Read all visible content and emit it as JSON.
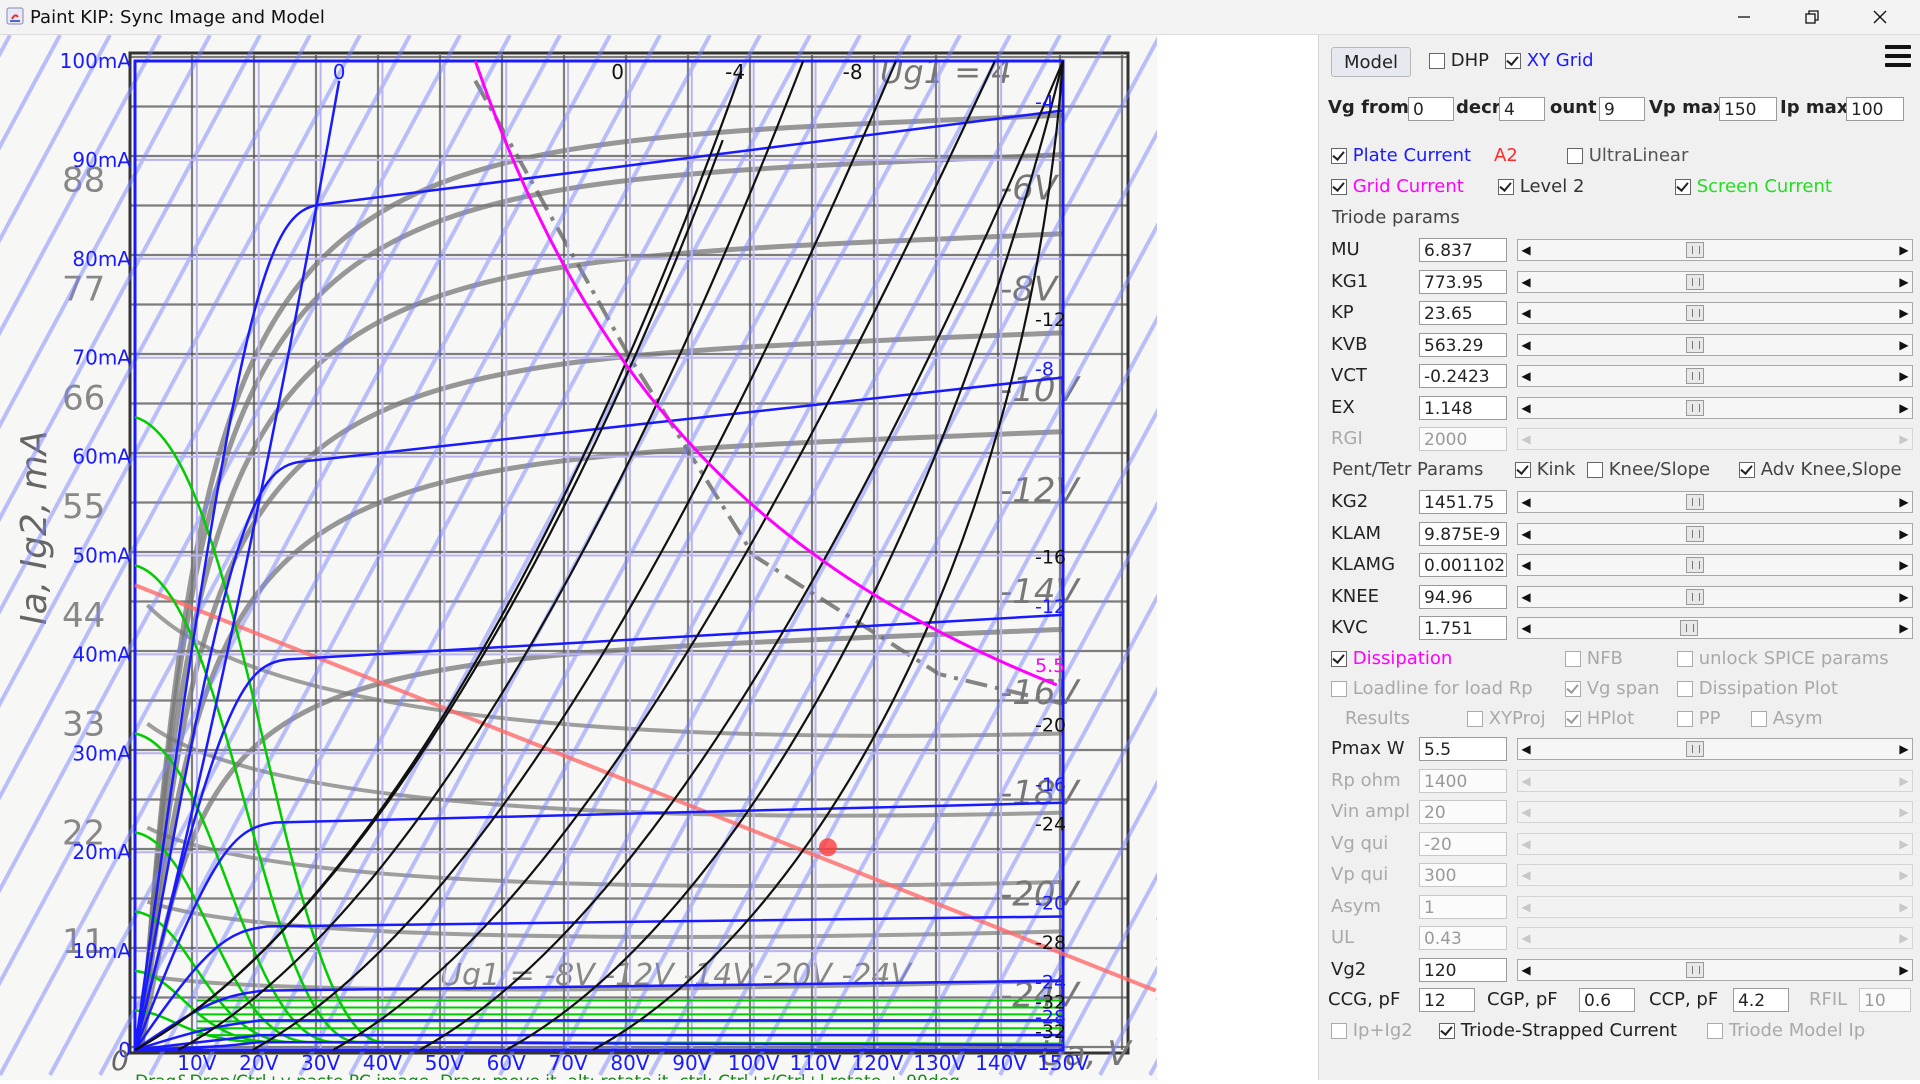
{
  "window": {
    "title": "Paint KIP: Sync Image and Model",
    "controls": [
      "minimize",
      "maximize",
      "close"
    ]
  },
  "plot": {
    "y_ticks": [
      "100mA",
      "90mA",
      "80mA",
      "70mA",
      "60mA",
      "50mA",
      "40mA",
      "30mA",
      "20mA",
      "10mA",
      "0"
    ],
    "x_ticks": [
      "10V",
      "20V",
      "30V",
      "40V",
      "50V",
      "60V",
      "70V",
      "80V",
      "90V",
      "100V",
      "110V",
      "120V",
      "130V",
      "140V",
      "150V"
    ],
    "x_origin": "0",
    "top_grid_labels": [
      "0",
      "0",
      "-4",
      "-8"
    ],
    "right_curve_labels": [
      "-4",
      "-12",
      "-8",
      "-16",
      "-12",
      "5.5",
      "-20",
      "-16",
      "-24",
      "-20",
      "-28",
      "-24",
      "-32",
      "-28",
      "-32"
    ],
    "scan_y_axis_label": "Ia, Ig2, mA",
    "scan_x_label": "Ua, V",
    "scan_grid_curve_labels": [
      "-6V",
      "-8V",
      "-10V",
      "-12V",
      "-14V",
      "-16V",
      "-18V",
      "-20V",
      "-24V"
    ],
    "scan_bottom_labels": "Ug1 = -8V  -12V  -14V  -20V  -24V",
    "scan_top_label": "Ug1 = 4",
    "scan_left_numbers": [
      "88",
      "77",
      "66",
      "55",
      "44",
      "33",
      "22",
      "11"
    ],
    "status_hint": "Drag&Drop/Ctrl+v paste PC image. Drag: move it, alt: rotate it, ctrl: Ctrl+r/Ctrl+l rotate + 90deg",
    "colors": {
      "plate": "#1a1aff",
      "grid_current": "#ff00ff",
      "screen": "#00cc00",
      "model": "#000000",
      "xy_grid": "#7a86ff",
      "load": "#ff6b6b"
    }
  },
  "panel": {
    "model_button": "Model",
    "dhp": {
      "label": "DHP",
      "checked": false
    },
    "xy_grid": {
      "label": "XY Grid",
      "checked": true
    },
    "vg_from": {
      "label": "Vg from",
      "value": "0"
    },
    "decr": {
      "label": "decr",
      "value": "4"
    },
    "count": {
      "label": "ount",
      "value": "9"
    },
    "vp_max": {
      "label": "Vp max",
      "value": "150"
    },
    "ip_max": {
      "label": "Ip max",
      "value": "100"
    },
    "plate_current": {
      "label": "Plate Current",
      "checked": true
    },
    "a2": "A2",
    "ultralinear": {
      "label": "UltraLinear",
      "checked": false
    },
    "grid_current": {
      "label": "Grid Current",
      "checked": true
    },
    "level2": {
      "label": "Level 2",
      "checked": true
    },
    "screen_current": {
      "label": "Screen Current",
      "checked": true
    },
    "triode_params_header": "Triode params",
    "triode_params": [
      {
        "name": "MU",
        "value": "6.837",
        "enabled": true,
        "pos": 0.44
      },
      {
        "name": "KG1",
        "value": "773.95",
        "enabled": true,
        "pos": 0.44
      },
      {
        "name": "KP",
        "value": "23.65",
        "enabled": true,
        "pos": 0.44
      },
      {
        "name": "KVB",
        "value": "563.29",
        "enabled": true,
        "pos": 0.44
      },
      {
        "name": "VCT",
        "value": "-0.2423",
        "enabled": true,
        "pos": 0.44
      },
      {
        "name": "EX",
        "value": "1.148",
        "enabled": true,
        "pos": 0.44
      },
      {
        "name": "RGI",
        "value": "2000",
        "enabled": false,
        "pos": null
      }
    ],
    "pent_header": "Pent/Tetr Params",
    "kink": {
      "label": "Kink",
      "checked": true
    },
    "knee_slope": {
      "label": "Knee/Slope",
      "checked": false
    },
    "adv_knee": {
      "label": "Adv Knee,Slope",
      "checked": true
    },
    "pent_params": [
      {
        "name": "KG2",
        "value": "1451.75",
        "enabled": true,
        "pos": 0.44
      },
      {
        "name": "KLAM",
        "value": "9.875E-9",
        "enabled": true,
        "pos": 0.44
      },
      {
        "name": "KLAMG",
        "value": "0.001102",
        "enabled": true,
        "pos": 0.44
      },
      {
        "name": "KNEE",
        "value": "94.96",
        "enabled": true,
        "pos": 0.44
      },
      {
        "name": "KVC",
        "value": "1.751",
        "enabled": true,
        "pos": 0.42
      }
    ],
    "dissipation": {
      "label": "Dissipation",
      "checked": true
    },
    "nfb": {
      "label": "NFB",
      "checked": false
    },
    "unlock_spice": {
      "label": "unlock SPICE params",
      "checked": false
    },
    "loadline": {
      "label": "Loadline for load Rp",
      "checked": false
    },
    "vg_span": {
      "label": "Vg span",
      "checked": true
    },
    "dissipation_plot": {
      "label": "Dissipation Plot",
      "checked": false
    },
    "results": "Results",
    "xyproj": {
      "label": "XYProj",
      "checked": false
    },
    "hplot": {
      "label": "HPlot",
      "checked": true
    },
    "pp": {
      "label": "PP",
      "checked": false
    },
    "asym_chk": {
      "label": "Asym",
      "checked": false
    },
    "load_params": [
      {
        "name": "Pmax W",
        "value": "5.5",
        "enabled": true,
        "pos": 0.44
      },
      {
        "name": "Rp ohm",
        "value": "1400",
        "enabled": false,
        "pos": null
      },
      {
        "name": "Vin ampl",
        "value": "20",
        "enabled": false,
        "pos": null
      },
      {
        "name": "Vg qui",
        "value": "-20",
        "enabled": false,
        "pos": null
      },
      {
        "name": "Vp qui",
        "value": "300",
        "enabled": false,
        "pos": null
      },
      {
        "name": "Asym",
        "value": "1",
        "enabled": false,
        "pos": null
      },
      {
        "name": "UL",
        "value": "0.43",
        "enabled": false,
        "pos": null
      },
      {
        "name": "Vg2",
        "value": "120",
        "enabled": true,
        "pos": 0.44
      }
    ],
    "ccg": {
      "label": "CCG, pF",
      "value": "12"
    },
    "cgp": {
      "label": "CGP, pF",
      "value": "0.6"
    },
    "ccp": {
      "label": "CCP, pF",
      "value": "4.2"
    },
    "rfil": {
      "label": "RFIL",
      "value": "10"
    },
    "ip_ig2": {
      "label": "Ip+Ig2",
      "checked": false
    },
    "triode_strapped": {
      "label": "Triode-Strapped Current",
      "checked": true
    },
    "triode_model_ip": {
      "label": "Triode Model Ip",
      "checked": false
    }
  }
}
